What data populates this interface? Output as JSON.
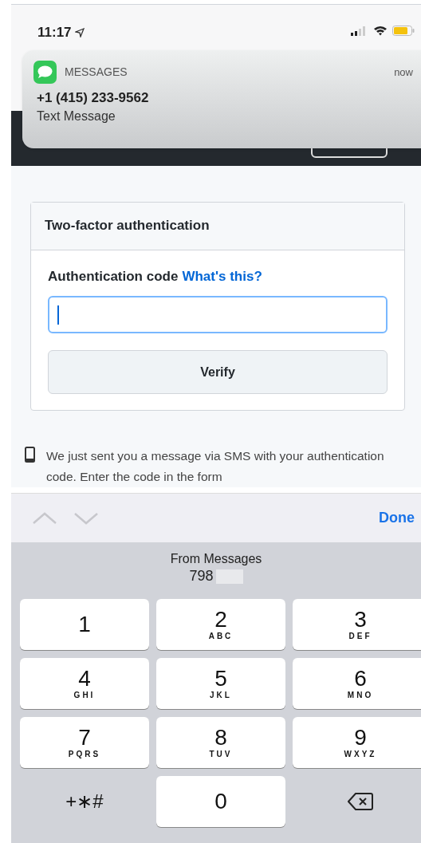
{
  "status_bar": {
    "time": "11:17"
  },
  "notification": {
    "app": "MESSAGES",
    "time": "now",
    "sender": "+1 (415) 233-9562",
    "body": "Text Message"
  },
  "card": {
    "title": "Two-factor authentication",
    "field_label": "Authentication code",
    "help_link": "What's this?",
    "verify_button": "Verify"
  },
  "sms_note": "We just sent you a message via SMS with your authentication code. Enter the code in the form",
  "keyboard_toolbar": {
    "done": "Done"
  },
  "suggestion": {
    "source": "From Messages",
    "code": "798"
  },
  "keys": [
    {
      "kind": "digit",
      "digit": "1"
    },
    {
      "kind": "digit",
      "digit": "2",
      "letters": "ABC"
    },
    {
      "kind": "digit",
      "digit": "3",
      "letters": "DEF"
    },
    {
      "kind": "digit",
      "digit": "4",
      "letters": "GHI"
    },
    {
      "kind": "digit",
      "digit": "5",
      "letters": "JKL"
    },
    {
      "kind": "digit",
      "digit": "6",
      "letters": "MNO"
    },
    {
      "kind": "digit",
      "digit": "7",
      "letters": "PQRS"
    },
    {
      "kind": "digit",
      "digit": "8",
      "letters": "TUV"
    },
    {
      "kind": "digit",
      "digit": "9",
      "letters": "WXYZ"
    },
    {
      "kind": "symbols",
      "label": "+∗#"
    },
    {
      "kind": "digit",
      "digit": "0"
    },
    {
      "kind": "delete"
    }
  ]
}
